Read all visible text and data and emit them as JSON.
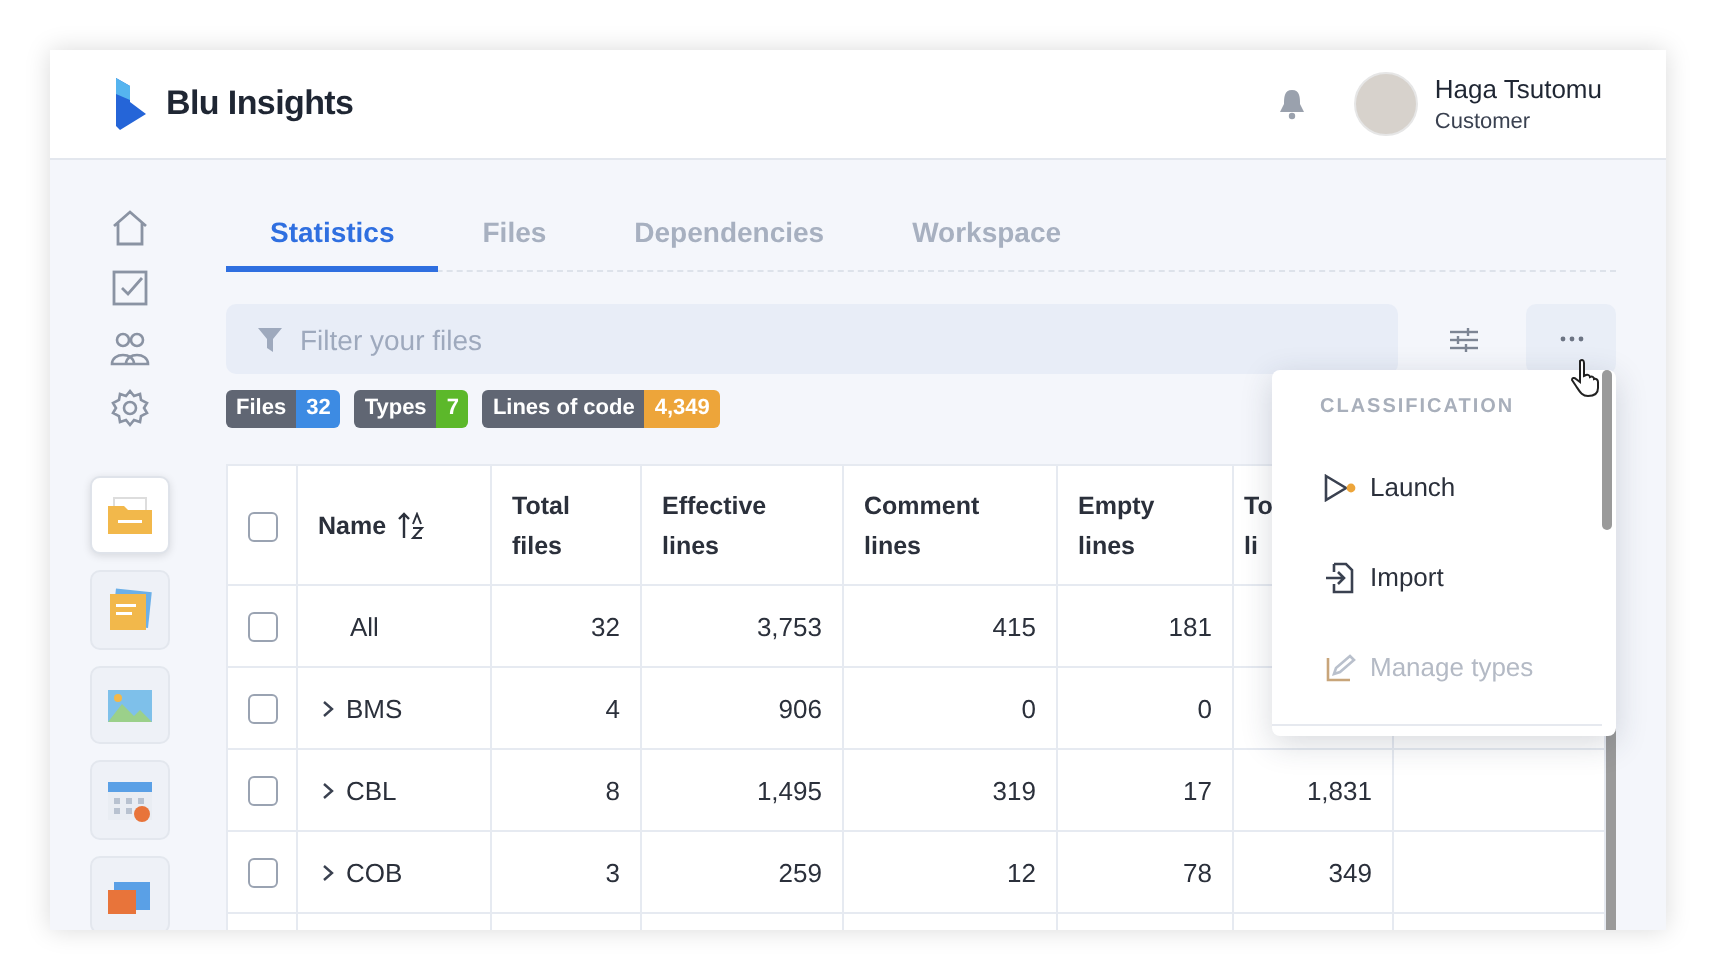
{
  "app": {
    "name": "Blu Insights"
  },
  "user": {
    "name": "Haga Tsutomu",
    "role": "Customer"
  },
  "sidebar": {
    "tiles": [
      {
        "kind": "folder",
        "selected": true
      },
      {
        "kind": "notes",
        "selected": false
      },
      {
        "kind": "picture",
        "selected": false
      },
      {
        "kind": "calendar",
        "selected": false
      },
      {
        "kind": "stack",
        "selected": false
      }
    ]
  },
  "tabs": [
    {
      "label": "Statistics",
      "selected": true
    },
    {
      "label": "Files",
      "selected": false
    },
    {
      "label": "Dependencies",
      "selected": false
    },
    {
      "label": "Workspace",
      "selected": false
    }
  ],
  "filter": {
    "placeholder": "Filter your files"
  },
  "badges": [
    {
      "label": "Files",
      "count": "32",
      "color": "#3d8be3"
    },
    {
      "label": "Types",
      "count": "7",
      "color": "#5cb82a"
    },
    {
      "label": "Lines of code",
      "count": "4,349",
      "color": "#eda53a"
    }
  ],
  "table": {
    "header_checked": false,
    "columns": [
      "Name",
      "Total files",
      "Effective lines",
      "Comment lines",
      "Empty lines",
      "To li"
    ],
    "rows": [
      {
        "kind": "total",
        "checked": false,
        "cells": [
          "All",
          "32",
          "3,753",
          "415",
          "181"
        ]
      },
      {
        "kind": "group",
        "checked": false,
        "cells": [
          "BMS",
          "4",
          "906",
          "0",
          "0"
        ]
      },
      {
        "kind": "group",
        "checked": false,
        "cells": [
          "CBL",
          "8",
          "1,495",
          "319",
          "17",
          "1,831"
        ]
      },
      {
        "kind": "group",
        "checked": false,
        "cells": [
          "COB",
          "3",
          "259",
          "12",
          "78",
          "349"
        ]
      }
    ]
  },
  "menu": {
    "sections": [
      {
        "title": "CLASSIFICATION",
        "items": [
          {
            "kind": "launch",
            "label": "Launch",
            "disabled": false
          },
          {
            "kind": "import",
            "label": "Import",
            "disabled": false
          },
          {
            "kind": "manage",
            "label": "Manage types",
            "disabled": true
          }
        ]
      }
    ]
  }
}
